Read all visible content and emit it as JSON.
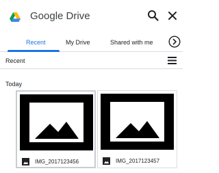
{
  "header": {
    "title": "Google Drive",
    "logo_icon": "google-drive-logo",
    "search_icon": "search-icon",
    "close_icon": "close-icon"
  },
  "tabs": [
    {
      "label": "Recent",
      "active": true
    },
    {
      "label": "My Drive",
      "active": false
    },
    {
      "label": "Shared with me",
      "active": false
    }
  ],
  "tab_scroll_icon": "chevron-right-circle-icon",
  "toolbar": {
    "sort_label": "Recent",
    "view_icon": "list-view-icon"
  },
  "section": {
    "title": "Today"
  },
  "files": [
    {
      "name": "IMG_2017123456",
      "type_icon": "image-file-icon",
      "selected": true
    },
    {
      "name": "IMG_2017123457",
      "type_icon": "image-file-icon",
      "selected": false
    }
  ],
  "colors": {
    "accent": "#1a73e8",
    "divider": "#dadce0",
    "text": "#202124"
  }
}
